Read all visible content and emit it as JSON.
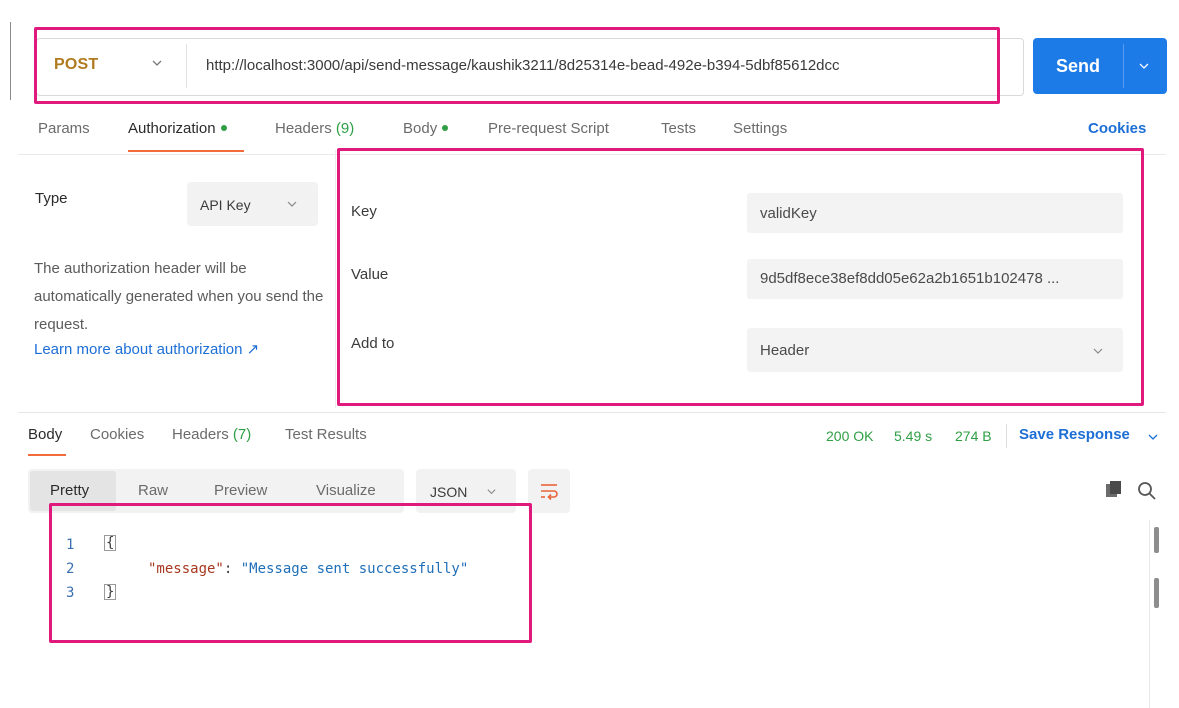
{
  "request": {
    "method": "POST",
    "url": "http://localhost:3000/api/send-message/kaushik3211/8d25314e-bead-492e-b394-5dbf85612dcc",
    "send_label": "Send"
  },
  "tabs": {
    "items": [
      {
        "label": "Params"
      },
      {
        "label": "Authorization"
      },
      {
        "label": "Headers",
        "count": "(9)"
      },
      {
        "label": "Body"
      },
      {
        "label": "Pre-request Script"
      },
      {
        "label": "Tests"
      },
      {
        "label": "Settings"
      }
    ],
    "cookies_label": "Cookies"
  },
  "auth": {
    "type_label": "Type",
    "type_value": "API Key",
    "description": "The authorization header will be automatically generated when you send the request.",
    "learn_more": "Learn more about authorization ↗",
    "fields": [
      {
        "label": "Key",
        "value": "validKey"
      },
      {
        "label": "Value",
        "value": "9d5df8ece38ef8dd05e62a2b1651b102478 ..."
      },
      {
        "label": "Add to",
        "value": "Header"
      }
    ]
  },
  "response": {
    "tabs": [
      {
        "label": "Body"
      },
      {
        "label": "Cookies"
      },
      {
        "label": "Headers",
        "count": "(7)"
      },
      {
        "label": "Test Results"
      }
    ],
    "status": "200 OK",
    "time": "5.49 s",
    "size": "274 B",
    "save_label": "Save Response",
    "view_options": [
      "Pretty",
      "Raw",
      "Preview",
      "Visualize"
    ],
    "format": "JSON",
    "code": {
      "line_numbers": [
        "1",
        "2",
        "3"
      ],
      "open_brace": "{",
      "close_brace": "}",
      "key": "\"message\"",
      "colon": ": ",
      "value": "\"Message sent successfully\""
    }
  },
  "colors": {
    "accent": "#1d7be8",
    "method": "#b07a1f",
    "active_tab": "#f26b3a",
    "status_ok": "#2f9e44",
    "highlight": "#e0197d"
  },
  "icons": [
    "chevron-down-icon",
    "external-link-icon",
    "wrap-lines-icon",
    "copy-icon",
    "search-icon"
  ]
}
